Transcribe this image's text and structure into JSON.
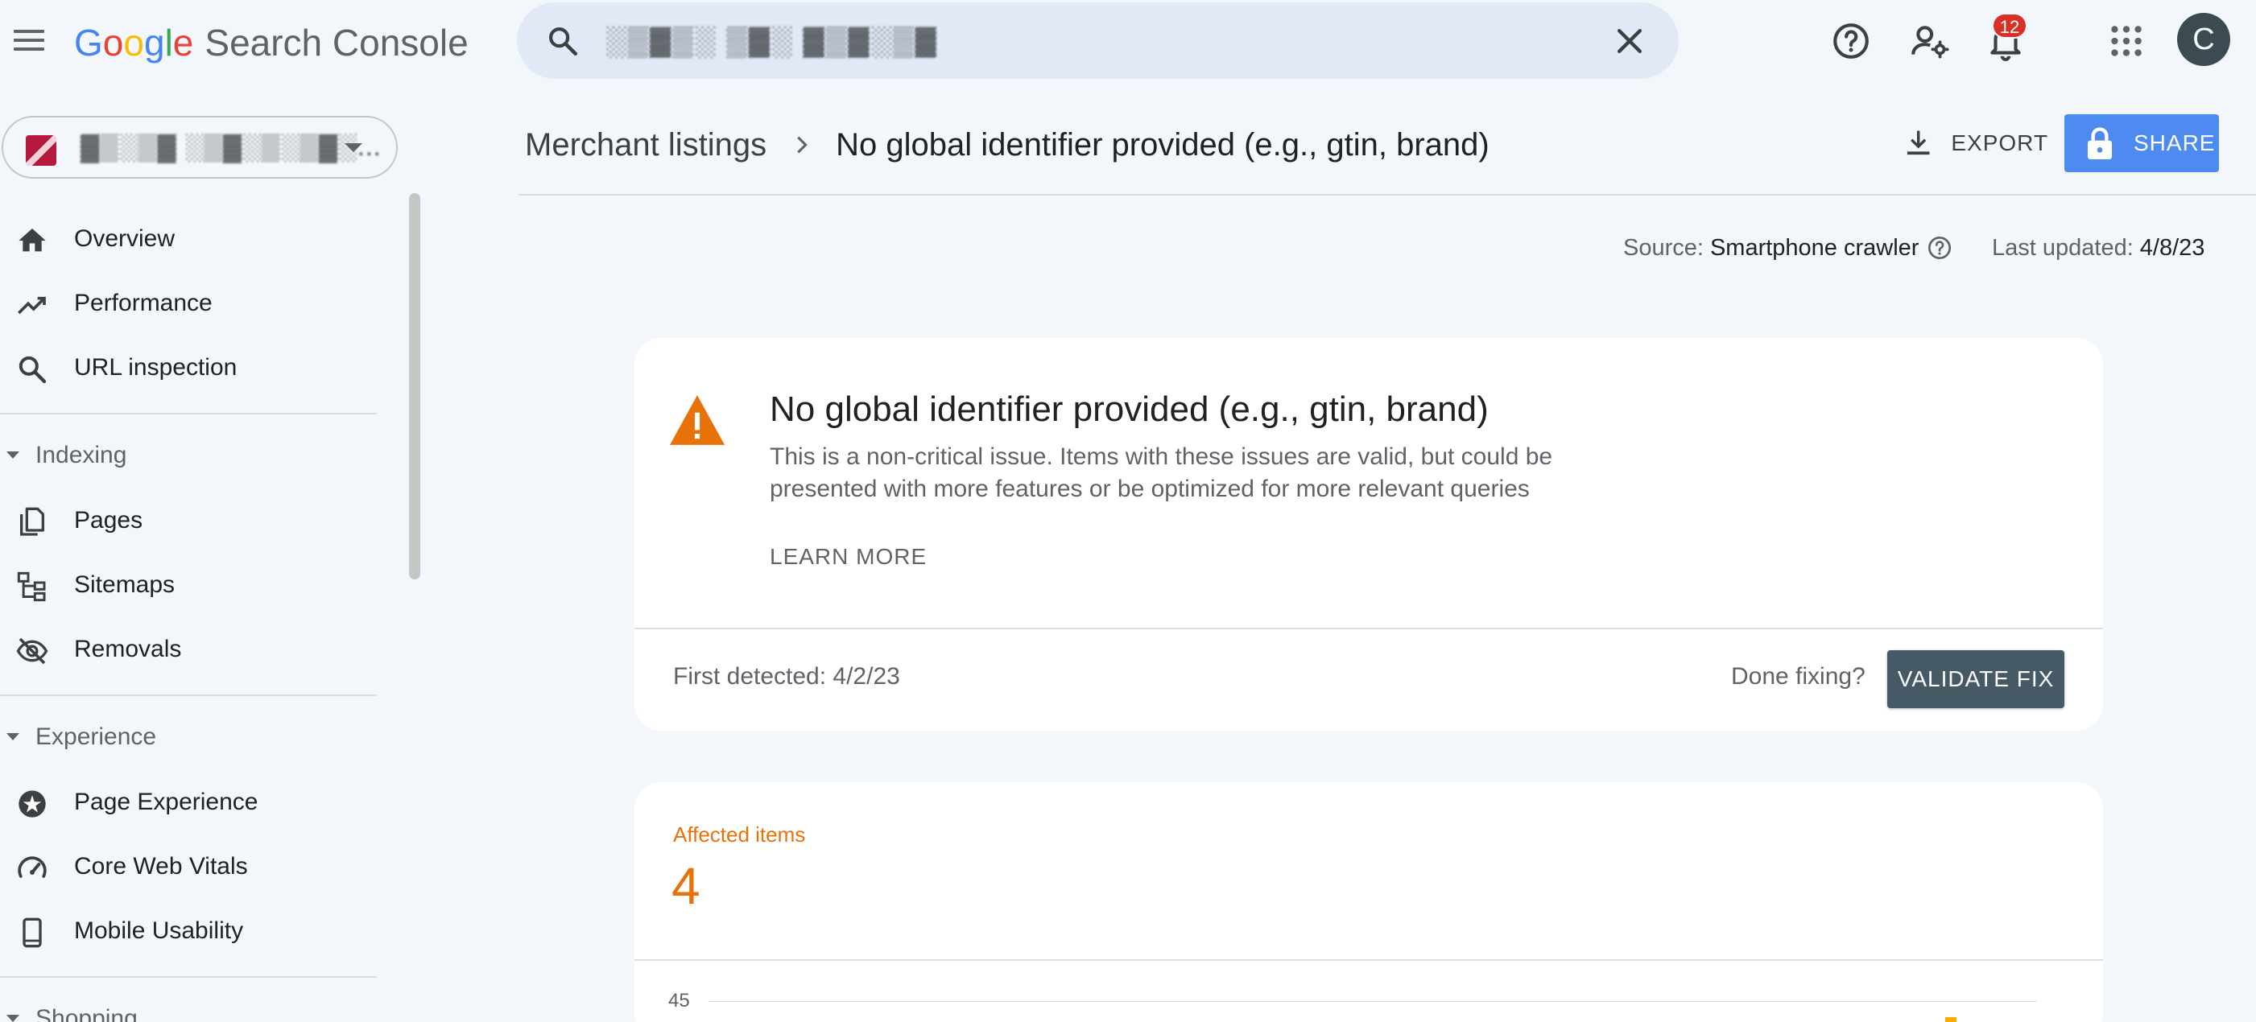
{
  "app": {
    "google_letters": [
      "G",
      "o",
      "o",
      "g",
      "l",
      "e"
    ],
    "product": "Search Console"
  },
  "search": {
    "value": "░▒▓▒░ ▒▓░ ▓▒▓░▒▓"
  },
  "notifications": {
    "count": "12"
  },
  "user": {
    "avatar_letter": "C"
  },
  "property": {
    "url": "▓▒░▒▓ ░▒▓░▒░▒▓░..."
  },
  "sidebar": {
    "top_items": [
      {
        "label": "Overview",
        "icon": "home-icon"
      },
      {
        "label": "Performance",
        "icon": "trending-up-icon"
      },
      {
        "label": "URL inspection",
        "icon": "search-icon"
      }
    ],
    "sections": [
      {
        "title": "Indexing",
        "items": [
          {
            "label": "Pages",
            "icon": "pages-icon"
          },
          {
            "label": "Sitemaps",
            "icon": "sitemap-icon"
          },
          {
            "label": "Removals",
            "icon": "visibility-off-icon"
          }
        ]
      },
      {
        "title": "Experience",
        "items": [
          {
            "label": "Page Experience",
            "icon": "page-experience-icon"
          },
          {
            "label": "Core Web Vitals",
            "icon": "speed-icon"
          },
          {
            "label": "Mobile Usability",
            "icon": "smartphone-icon"
          }
        ]
      },
      {
        "title": "Shopping",
        "items": []
      }
    ]
  },
  "breadcrumb": {
    "parent": "Merchant listings",
    "current": "No global identifier provided (e.g., gtin, brand)"
  },
  "actions": {
    "export_label": "EXPORT",
    "share_label": "SHARE"
  },
  "meta": {
    "source_key": "Source:",
    "source_value": "Smartphone crawler",
    "updated_key": "Last updated:",
    "updated_value": "4/8/23"
  },
  "issue": {
    "title": "No global identifier provided (e.g., gtin, brand)",
    "description": "This is a non-critical issue. Items with these issues are valid, but could be presented with more features or be optimized for more relevant queries",
    "learn_more": "LEARN MORE",
    "first_detected": "First detected: 4/2/23",
    "done_fixing": "Done fixing?",
    "validate_label": "VALIDATE FIX"
  },
  "affected": {
    "label": "Affected items",
    "count": "4"
  },
  "chart_data": {
    "type": "line",
    "y_ticks": [
      "45"
    ]
  },
  "colors": {
    "accent_blue": "#4d8bf0",
    "warning_orange": "#e8710a",
    "validate_button": "#455a64",
    "badge_red": "#d93025"
  }
}
